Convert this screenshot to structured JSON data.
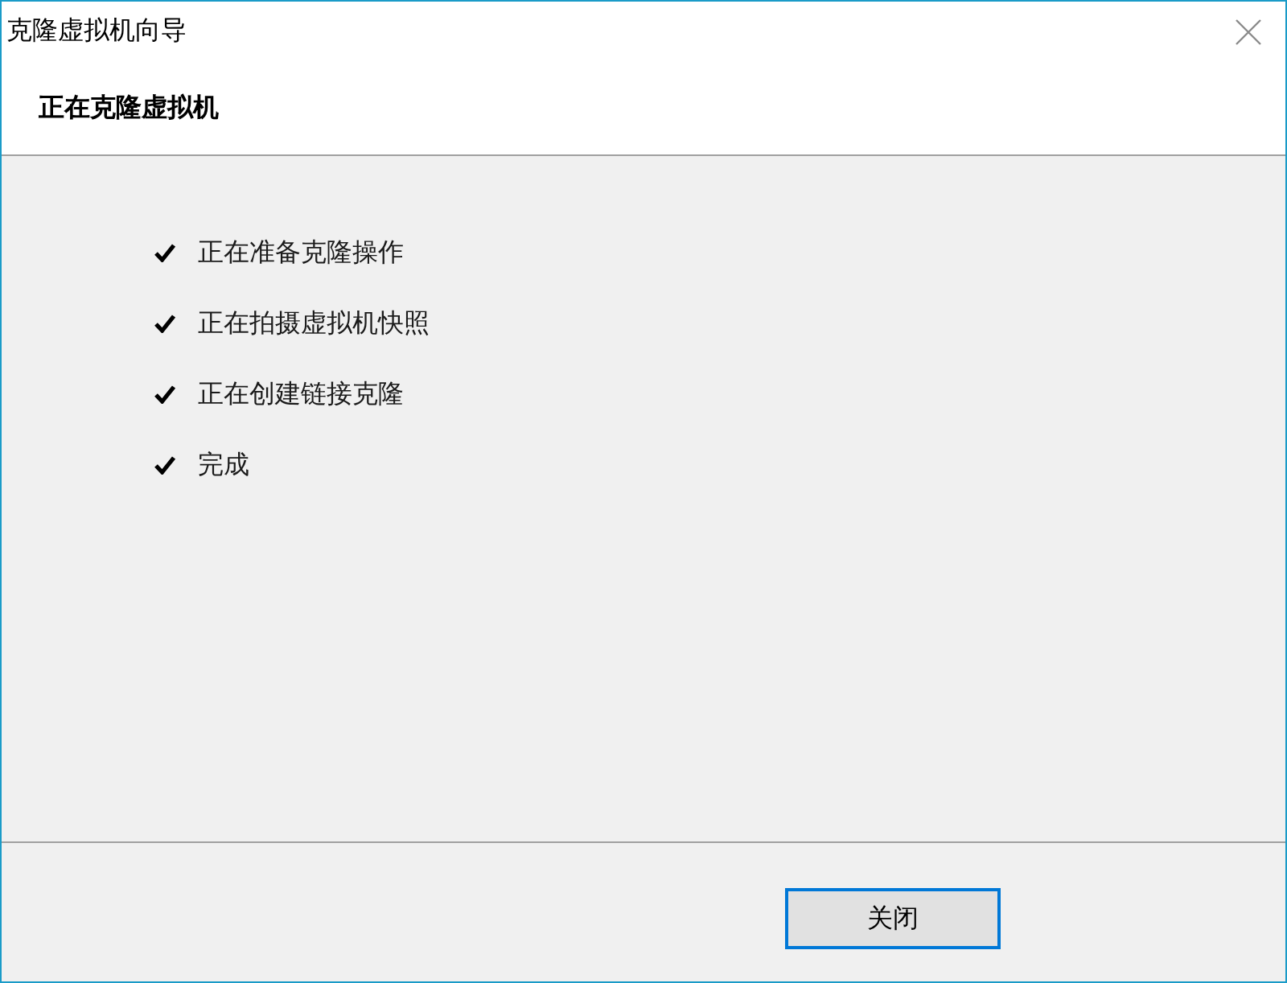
{
  "window": {
    "title": "克隆虚拟机向导"
  },
  "header": {
    "title": "正在克隆虚拟机"
  },
  "steps": [
    {
      "label": "正在准备克隆操作",
      "checked": true
    },
    {
      "label": "正在拍摄虚拟机快照",
      "checked": true
    },
    {
      "label": "正在创建链接克隆",
      "checked": true
    },
    {
      "label": "完成",
      "checked": true
    }
  ],
  "buttons": [
    {
      "label": "关闭",
      "focused": true
    }
  ]
}
